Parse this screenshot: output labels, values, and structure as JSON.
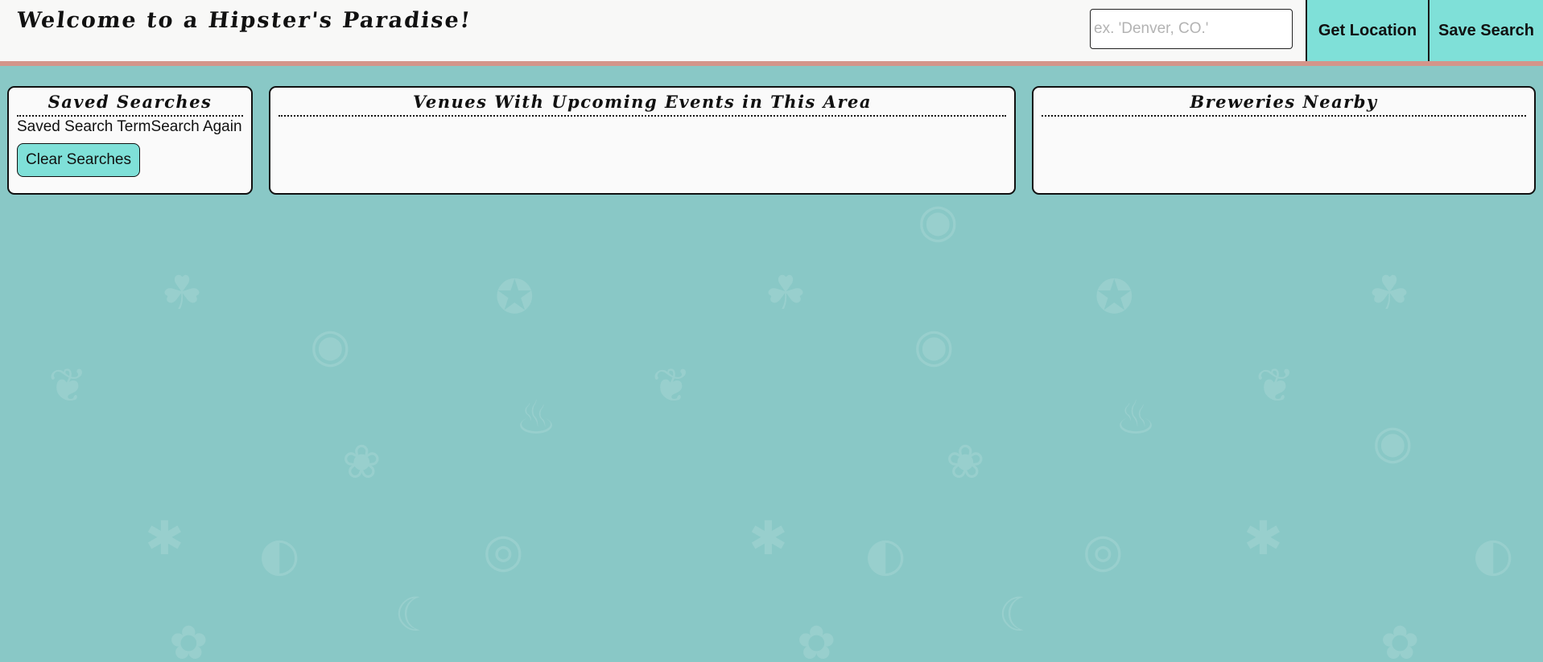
{
  "header": {
    "title": "Welcome to a Hipster's Paradise!",
    "search_placeholder": "ex. 'Denver, CO.'",
    "search_value": "",
    "get_location_label": "Get Location",
    "save_search_label": "Save Search"
  },
  "saved_searches": {
    "title": "Saved Searches",
    "items": [
      {
        "term": "Saved Search Term",
        "action": "Search Again"
      }
    ],
    "clear_label": "Clear Searches"
  },
  "venues": {
    "title": "Venues With Upcoming Events in This Area",
    "items": []
  },
  "breweries": {
    "title": "Breweries Nearby",
    "items": []
  },
  "colors": {
    "background": "#89c8c6",
    "header_background": "#f8f8f7",
    "header_border": "#d4958a",
    "button_accent": "#7fe0d8",
    "panel_background": "#fafafa"
  },
  "background_icons": [
    "pineapple-icon",
    "watermelon-icon",
    "donut-icon",
    "banana-icon",
    "grapes-icon",
    "cocktail-icon",
    "cherry-icon",
    "grill-icon",
    "broccoli-icon",
    "turkey-icon",
    "citrus-icon"
  ]
}
